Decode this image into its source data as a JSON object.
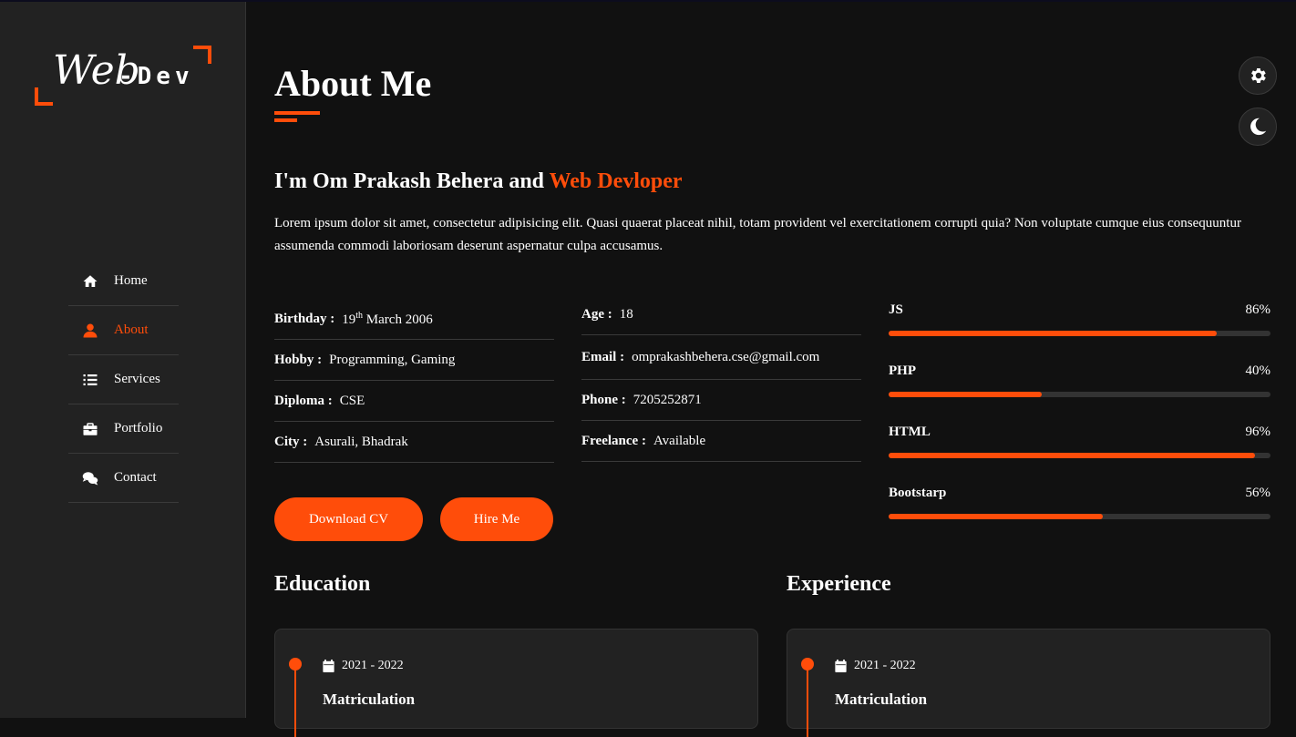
{
  "logo": {
    "script": "Web",
    "rest": "-Dev"
  },
  "nav": {
    "items": [
      {
        "label": "Home",
        "icon": "home-icon"
      },
      {
        "label": "About",
        "icon": "user-icon",
        "active": true
      },
      {
        "label": "Services",
        "icon": "list-icon"
      },
      {
        "label": "Portfolio",
        "icon": "briefcase-icon"
      },
      {
        "label": "Contact",
        "icon": "comments-icon"
      }
    ]
  },
  "page": {
    "title": "About Me",
    "subtitle_prefix": "I'm Om Prakash Behera and ",
    "subtitle_highlight": "Web Devloper",
    "intro": "Lorem ipsum dolor sit amet, consectetur adipisicing elit. Quasi quaerat placeat nihil, totam provident vel exercitationem corrupti quia? Non voluptate cumque eius consequuntur assumenda commodi laboriosam deserunt aspernatur culpa accusamus."
  },
  "info_left": [
    {
      "key": "Birthday :",
      "value_day": "19",
      "value_sup": "th",
      "value_rest": " March 2006"
    },
    {
      "key": "Hobby :",
      "value": "Programming, Gaming"
    },
    {
      "key": "Diploma :",
      "value": "CSE"
    },
    {
      "key": "City :",
      "value": "Asurali, Bhadrak"
    }
  ],
  "info_right": [
    {
      "key": "Age :",
      "value": "18"
    },
    {
      "key": "Email :",
      "value": "omprakashbehera.cse@gmail.com"
    },
    {
      "key": "Phone :",
      "value": "7205252871"
    },
    {
      "key": "Freelance :",
      "value": "Available"
    }
  ],
  "skills": [
    {
      "name": "JS",
      "percent_label": "86%",
      "percent": 86
    },
    {
      "name": "PHP",
      "percent_label": "40%",
      "percent": 40
    },
    {
      "name": "HTML",
      "percent_label": "96%",
      "percent": 96
    },
    {
      "name": "Bootstarp",
      "percent_label": "56%",
      "percent": 56
    }
  ],
  "buttons": {
    "download_cv": "Download CV",
    "hire_me": "Hire Me"
  },
  "education": {
    "title": "Education",
    "date": "2021 - 2022",
    "item_title": "Matriculation"
  },
  "experience": {
    "title": "Experience",
    "date": "2021 - 2022",
    "item_title": "Matriculation"
  },
  "colors": {
    "accent": "#ff4d0a",
    "background": "#111111",
    "sidebar": "#222222"
  },
  "controls": {
    "settings_icon": "gear-icon",
    "theme_icon": "moon-icon"
  }
}
